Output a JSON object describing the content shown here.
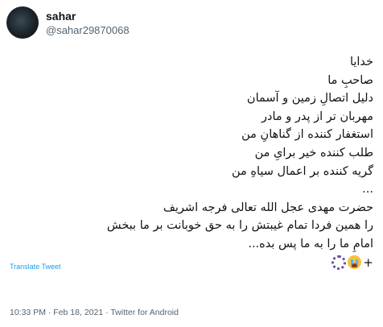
{
  "author": {
    "display_name": "sahar",
    "handle": "@sahar29870068"
  },
  "tweet": {
    "lines": [
      "خدایا",
      "صاحبِ ما",
      "دلیل اتصالِ زمین و آسمان",
      "مهربان تر از پدر و مادر",
      "استغفار کننده از گناهانِ من",
      "طلب کننده خیر برایِ من",
      "گریه کننده بر اعمال سیاهِ من",
      "...",
      "حضرت مهدی عجل الله تعالی فرجه اشریف",
      "را همین فردا تمام غیبتش را به حق خوبانت بر ما ببخش",
      "امامِ ما را به ما پس بده..."
    ],
    "last_line_plus": "+",
    "emojis": [
      "crying-face-icon",
      "prayer-beads-icon"
    ]
  },
  "translate_label": "Translate Tweet",
  "meta": {
    "time": "10:33 PM",
    "sep1": " · ",
    "date": "Feb 18, 2021",
    "sep2": " · ",
    "source": "Twitter for Android"
  }
}
